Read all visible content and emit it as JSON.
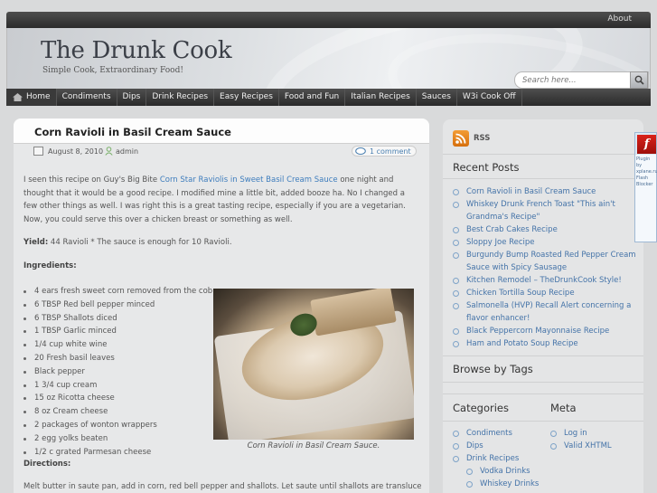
{
  "topbar": {
    "about": "About"
  },
  "header": {
    "title": "The Drunk Cook",
    "tagline": "Simple Cook, Extraordinary Food!",
    "search_placeholder": "Search here..."
  },
  "nav": [
    "Home",
    "Condiments",
    "Dips",
    "Drink Recipes",
    "Easy Recipes",
    "Food and Fun",
    "Italian Recipes",
    "Sauces",
    "W3i Cook Off"
  ],
  "post": {
    "title": "Corn Ravioli in Basil Cream Sauce",
    "date": "August 8, 2010",
    "author": "admin",
    "comments": "1 comment",
    "intro_before": "I seen this recipe on Guy's Big Bite ",
    "intro_link": "Corn Star Raviolis in Sweet Basil Cream Sauce",
    "intro_after": " one night and thought that it would be a good recipe. I modified mine a little bit, added booze ha. No I changed a few other things as well. I was right this is a great tasting recipe, especially if you are a vegetarian. Now, you could serve this over a chicken breast or something as well.",
    "yield_label": "Yield:",
    "yield_text": " 44 Ravioli * The sauce is enough for 10 Ravioli.",
    "ingredients_label": "Ingredients:",
    "ingredients": [
      "4 ears fresh sweet corn removed from the cob",
      "6 TBSP Red bell pepper minced",
      "6 TBSP Shallots diced",
      "1 TBSP Garlic minced",
      "1/4 cup white wine",
      "20 Fresh basil leaves",
      "Black pepper",
      "1 3/4 cup cream",
      "15 oz Ricotta cheese",
      "8 oz Cream cheese",
      "2 packages of wonton wrappers",
      "2 egg yolks beaten",
      "1/2 c grated Parmesan cheese"
    ],
    "photo_caption": "Corn Ravioli in Basil Cream Sauce.",
    "directions_label": "Directions:",
    "directions_text": "Melt butter in saute pan, add in corn, red bell pepper and shallots. Let saute until shallots are translucent and"
  },
  "sidebar": {
    "rss": "RSS",
    "recent_title": "Recent Posts",
    "recent": [
      "Corn Ravioli in Basil Cream Sauce",
      "Whiskey Drunk French Toast \"This ain't Grandma's Recipe\"",
      "Best Crab Cakes Recipe",
      "Sloppy Joe Recipe",
      "Burgundy Bump Roasted Red Pepper Cream Sauce with Spicy Sausage",
      "Kitchen Remodel – TheDrunkCook Style!",
      "Chicken Tortilla Soup Recipe",
      "Salmonella (HVP) Recall Alert concerning a flavor enhancer!",
      "Black Peppercorn Mayonnaise Recipe",
      "Ham and Potato Soup Recipe"
    ],
    "tags_title": "Browse by Tags",
    "categories_title": "Categories",
    "categories": [
      "Condiments",
      "Dips",
      "Drink Recipes"
    ],
    "subcategories": [
      "Vodka Drinks",
      "Whiskey Drinks"
    ],
    "meta_title": "Meta",
    "meta": [
      "Log in",
      "Valid XHTML"
    ]
  },
  "flash": {
    "logo": "f",
    "text": "Plugin by xplane.ru Flash Blocker"
  },
  "colors": {
    "accent_link": "#3e7dbd",
    "nav_bg": "#2a2a2a",
    "rss_orange": "#e8861f"
  }
}
